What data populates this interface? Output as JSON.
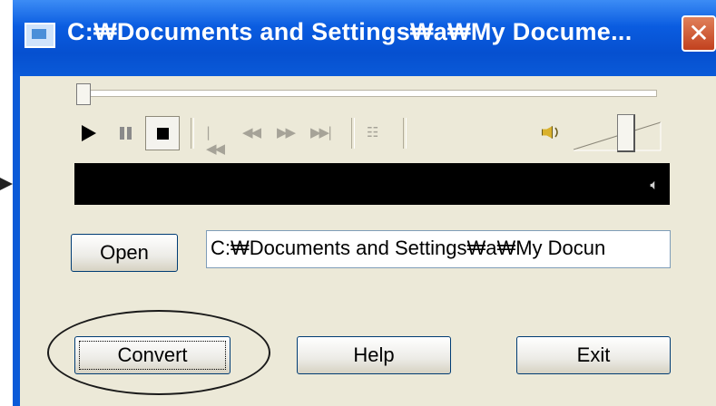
{
  "window": {
    "title": "C:₩Documents and Settings₩a₩My Docume...",
    "close_label": "✕"
  },
  "player": {
    "seek_position": 0,
    "volume_level": 0.65,
    "display_speaker_glyph": "🔈︎"
  },
  "controls": {
    "open_label": "Open",
    "path_value": "C:₩Documents and Settings₩a₩My Docun",
    "convert_label": "Convert",
    "help_label": "Help",
    "exit_label": "Exit"
  },
  "icons": {
    "play": "play-icon",
    "pause": "pause-icon",
    "stop": "stop-icon",
    "prev": "skip-previous-icon",
    "rewind": "rewind-icon",
    "forward": "fast-forward-icon",
    "next": "skip-next-icon",
    "playlist": "playlist-icon",
    "volume": "speaker-icon"
  },
  "colors": {
    "titlebar": "#0a5ad8",
    "client_bg": "#ece9d8",
    "close_button": "#c2411e"
  }
}
